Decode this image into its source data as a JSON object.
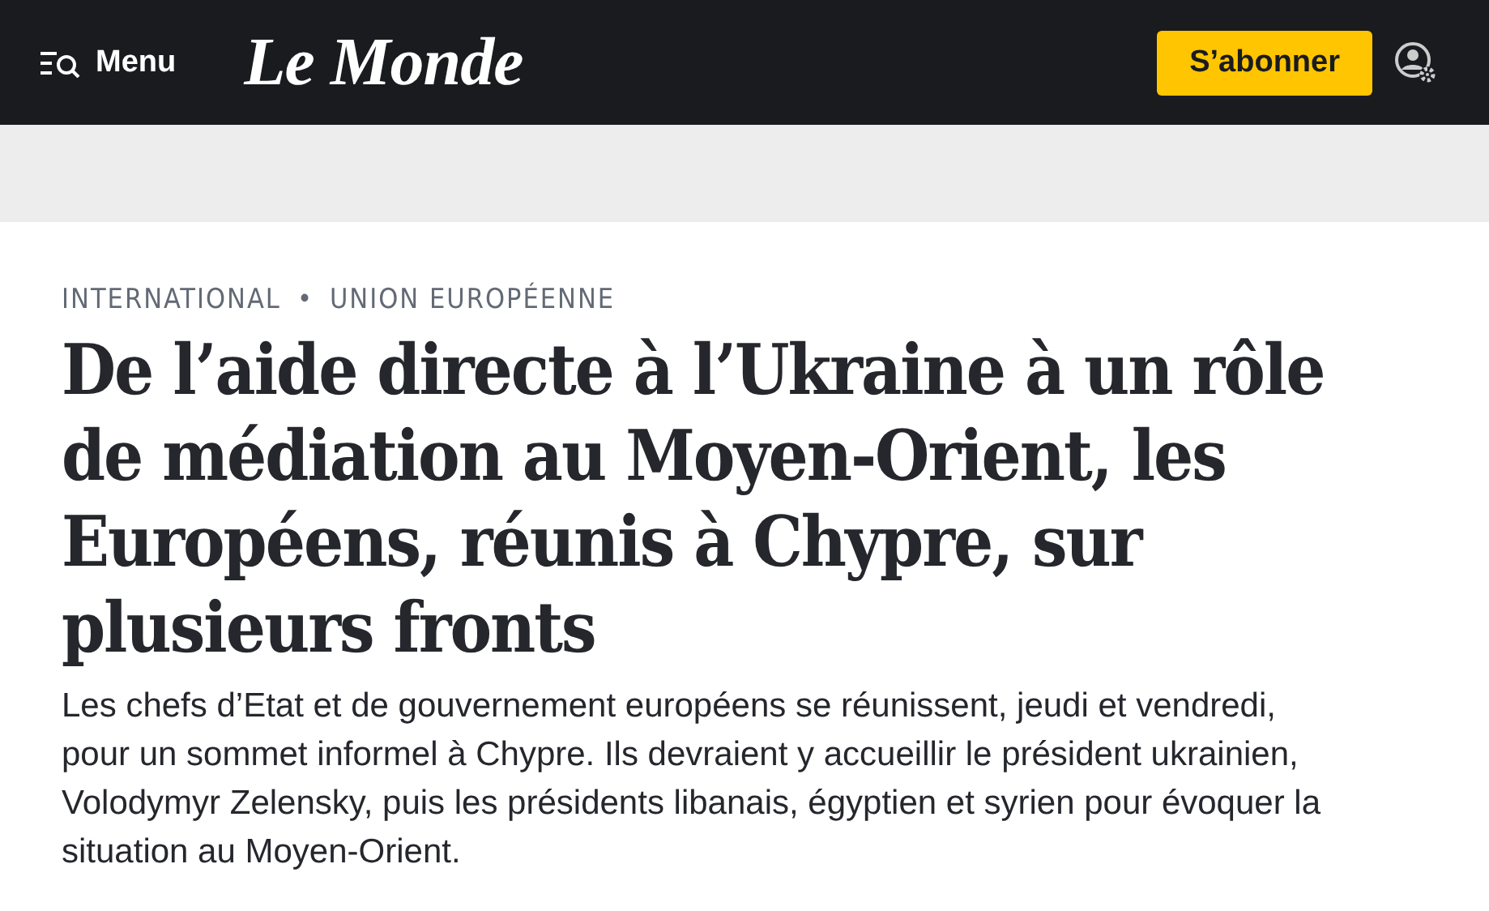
{
  "header": {
    "menu_label": "Menu",
    "logo": "Le Monde",
    "subscribe_label": "S’abonner"
  },
  "article": {
    "categories": [
      "INTERNATIONAL",
      "UNION EUROPÉENNE"
    ],
    "separator": "•",
    "headline": "De l’aide directe à l’Ukraine à un rôle de médiation au Moyen-Orient, les Européens, réunis à Chypre, sur plusieurs fronts",
    "lead": "Les chefs d’Etat et de gouvernement européens se réunissent, jeudi et vendredi, pour un sommet informel à Chypre. Ils devraient y accueillir le président ukrainien, Volodymyr Zelensky, puis les présidents libanais, égyptien et syrien pour évoquer la situation au Moyen-Orient."
  }
}
